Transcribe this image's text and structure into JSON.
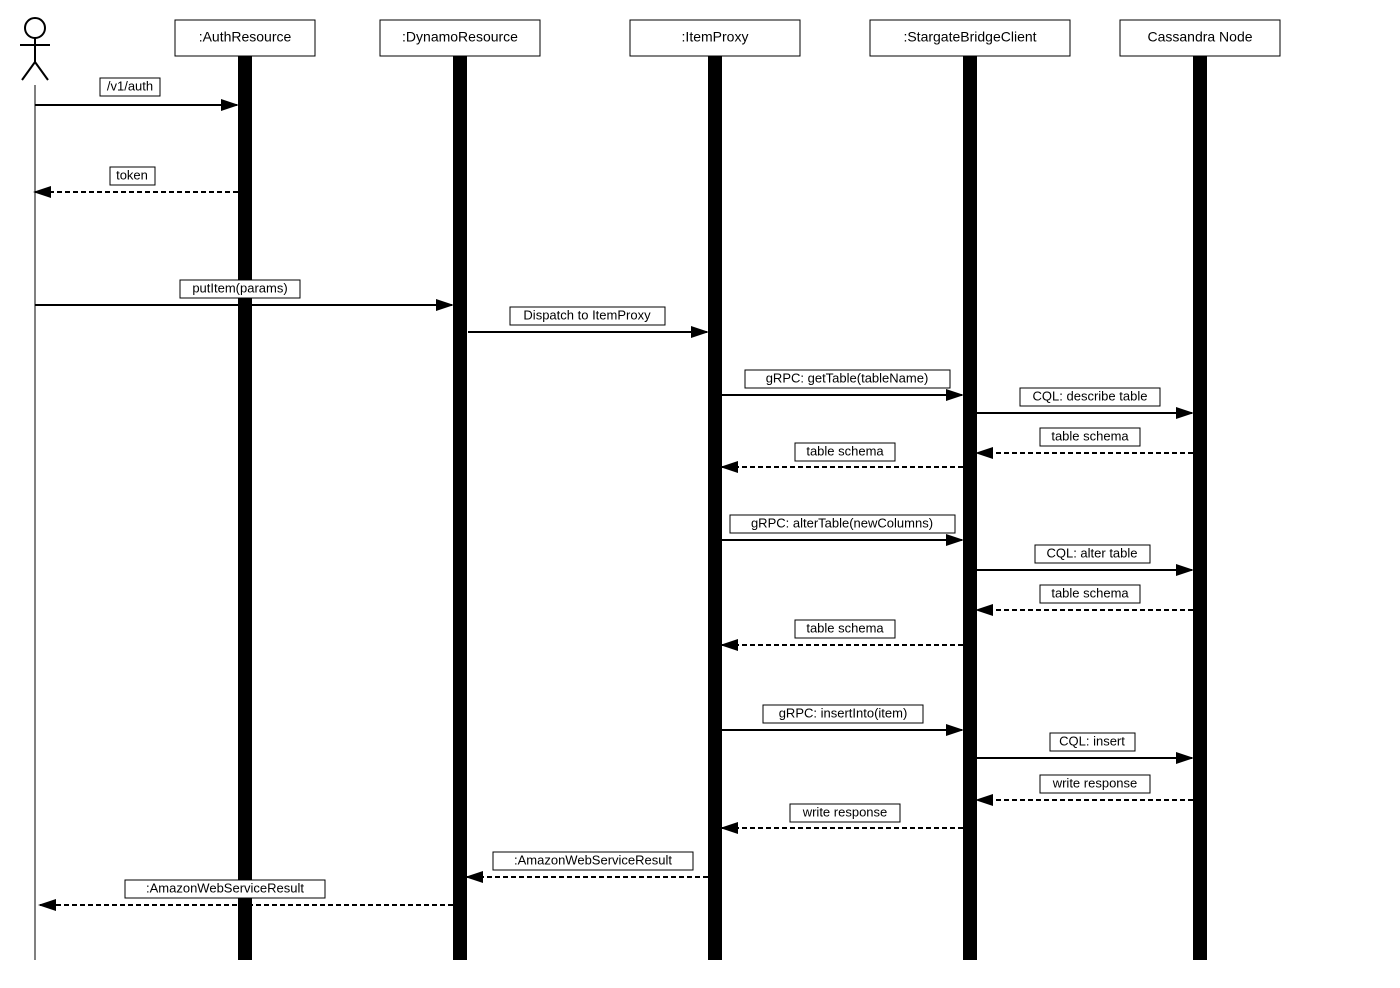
{
  "diagram": {
    "participants": {
      "auth": ":AuthResource",
      "dynamo": ":DynamoResource",
      "item": ":ItemProxy",
      "bridge": ":StargateBridgeClient",
      "cassandra": "Cassandra Node"
    },
    "messages": {
      "auth": "/v1/auth",
      "token": "token",
      "putItem": "putItem(params)",
      "dispatch": "Dispatch to ItemProxy",
      "getTable": "gRPC: getTable(tableName)",
      "describeTable": "CQL: describe table",
      "tableSchema1": "table schema",
      "tableSchema2": "table schema",
      "alterTable": "gRPC: alterTable(newColumns)",
      "cqlAlter": "CQL: alter table",
      "tableSchema3": "table schema",
      "tableSchema4": "table schema",
      "insertInto": "gRPC: insertInto(item)",
      "cqlInsert": "CQL: insert",
      "writeResponse1": "write response",
      "writeResponse2": "write response",
      "awsResult1": ":AmazonWebServiceResult",
      "awsResult2": ":AmazonWebServiceResult"
    }
  }
}
